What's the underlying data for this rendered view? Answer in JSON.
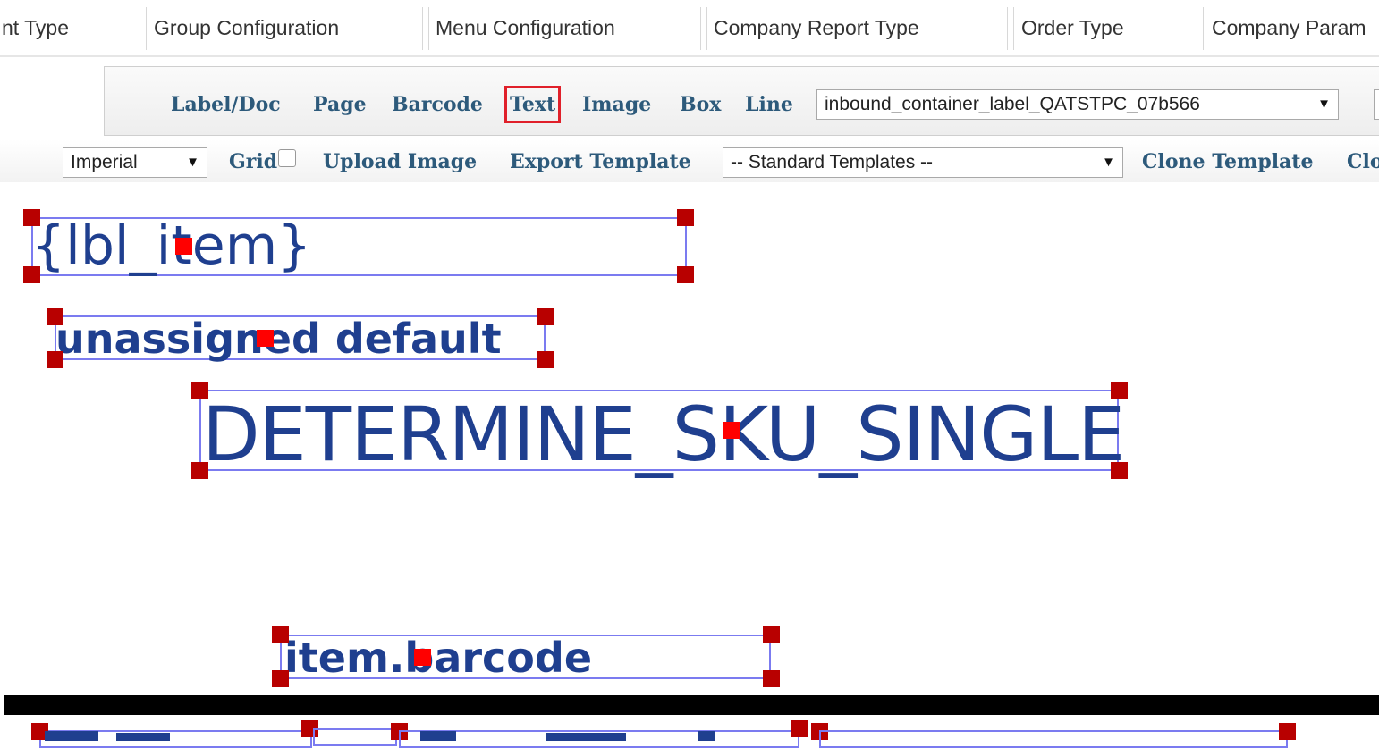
{
  "tabs": [
    "nt Type",
    "Group Configuration",
    "Menu Configuration",
    "Company Report Type",
    "Order Type",
    "Company Param"
  ],
  "toolbar": {
    "tools": [
      "Label/Doc",
      "Page",
      "Barcode",
      "Text",
      "Image",
      "Box",
      "Line"
    ],
    "highlighted_tool": "Text",
    "template_select": "inbound_container_label_QATSTPC_07b566"
  },
  "toolbar2": {
    "units": "Imperial",
    "grid_label": "Grid",
    "grid_checked": false,
    "upload_image": "Upload Image",
    "export_template": "Export Template",
    "standard_templates": "-- Standard Templates --",
    "clone_template": "Clone Template",
    "cut_off_item": "Clo"
  },
  "canvas": {
    "objects": [
      "{lbl_item}",
      "unassigned default",
      "DETERMINE_SKU_SINGLE",
      "item.barcode"
    ]
  },
  "colors": {
    "tool_text": "#2d5a7b",
    "highlight": "#e0202a",
    "handle": "#b80000",
    "center_handle": "#ff0000",
    "selection_border": "#7b7bf0",
    "label_text": "#1f3f8f"
  }
}
